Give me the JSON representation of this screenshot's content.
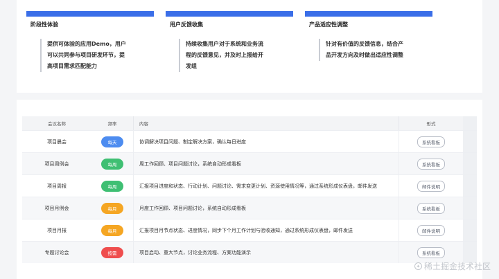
{
  "phases": [
    {
      "title": "阶段性体验",
      "lines": [
        "提供可体验的应用Demo，用户",
        "可以共同参与项目研发环节，提",
        "高项目需求匹配能力"
      ]
    },
    {
      "title": "用户反馈收集",
      "lines": [
        "持续收集用户对于系统和业务流",
        "程的反馈意见，并及时上报给开",
        "发组"
      ]
    },
    {
      "title": "产品适应性调整",
      "lines": [
        "针对有价值的反馈信息，结合产",
        "品开发方向及时做出适应性调整"
      ]
    }
  ],
  "table": {
    "headers": {
      "name": "会议名称",
      "freq": "频率",
      "content": "内容",
      "form": "形式"
    },
    "rows": [
      {
        "name": "项目晨会",
        "freq": "每天",
        "freq_color": "#4d8cf0",
        "content": "协调解决项目问题、制定解决方案，确认每日进度",
        "form": "系统看板"
      },
      {
        "name": "项目周例会",
        "freq": "每周",
        "freq_color": "#3fbf73",
        "content": "周工作回顾、项目问题讨论，系统自动形成看板",
        "form": "系统看板"
      },
      {
        "name": "项目周报",
        "freq": "每周",
        "freq_color": "#3fbf73",
        "content": "汇报项目进度和状态、行动计划、问题讨论、需求变更计划、资源使用情况等，通过系统形成仪表盘，邮件发送",
        "form": "邮件说明"
      },
      {
        "name": "项目月例会",
        "freq": "每月",
        "freq_color": "#f5a623",
        "content": "月度工作回顾、项目问题讨论，系统自动形成看板",
        "form": "系统看板"
      },
      {
        "name": "项目月报",
        "freq": "每月",
        "freq_color": "#f5a623",
        "content": "汇报项目月节点状态、进度情况，同步下个月工作计划与验收通知，通过系统形成仪表盘，邮件发送",
        "form": "邮件说明"
      },
      {
        "name": "专题讨论会",
        "freq": "按需",
        "freq_color": "#ef4e4e",
        "content": "项目启动、重大节点，讨论业务流程、方案功能演示",
        "form": "系统看板"
      }
    ]
  },
  "watermark": "稀土掘金技术社区"
}
